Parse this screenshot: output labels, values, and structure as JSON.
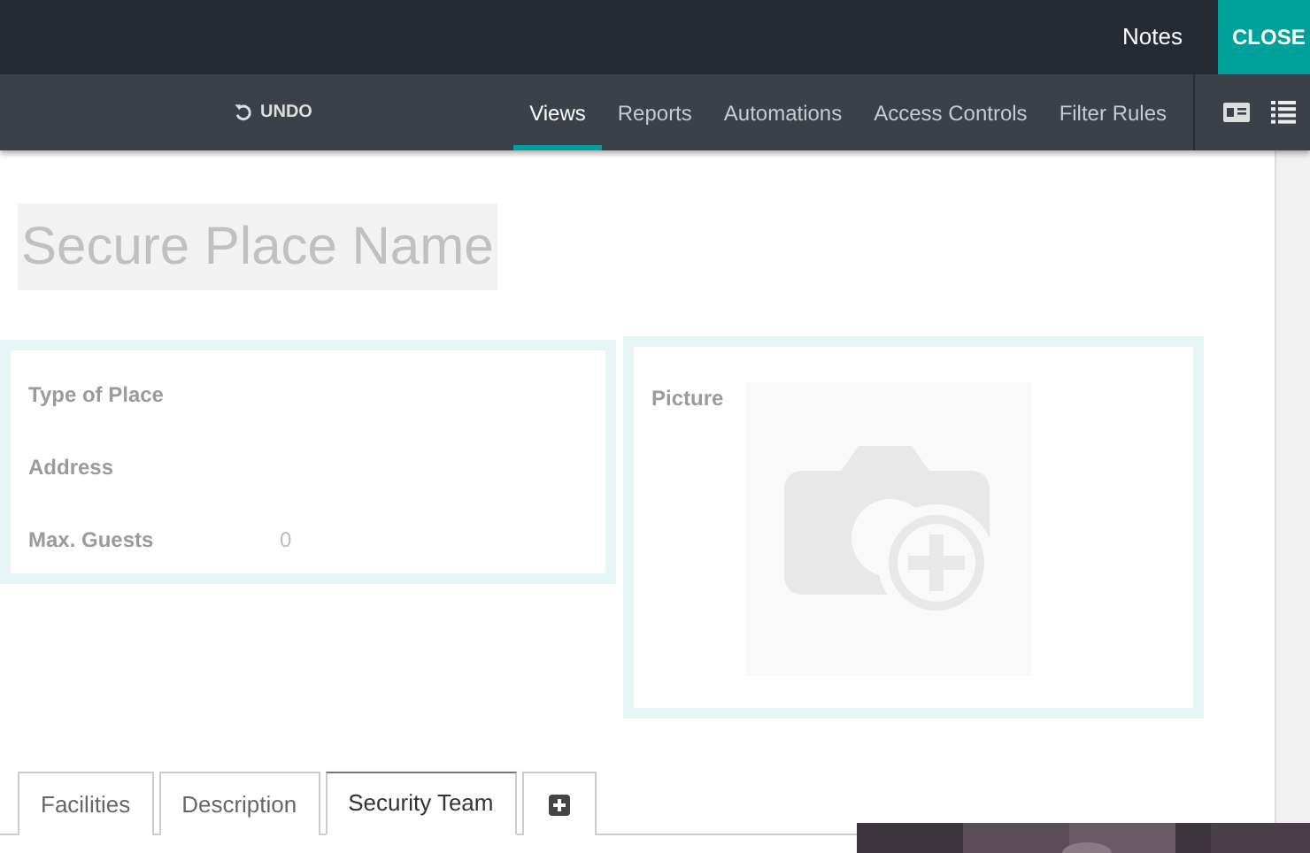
{
  "topbar": {
    "notes": "Notes",
    "close": "CLOSE"
  },
  "toolbar": {
    "undo": "UNDO",
    "menu": [
      {
        "label": "Views",
        "selected": true
      },
      {
        "label": "Reports",
        "selected": false
      },
      {
        "label": "Automations",
        "selected": false
      },
      {
        "label": "Access Controls",
        "selected": false
      },
      {
        "label": "Filter Rules",
        "selected": false
      }
    ]
  },
  "form": {
    "title_placeholder": "Secure Place Name",
    "fields": [
      {
        "label": "Type of Place"
      },
      {
        "label": "Address"
      },
      {
        "label": "Max. Guests",
        "value": "0"
      }
    ],
    "picture_label": "Picture",
    "tabs": [
      {
        "label": "Facilities",
        "selected": false
      },
      {
        "label": "Description",
        "selected": false
      },
      {
        "label": "Security Team",
        "selected": true
      }
    ]
  }
}
